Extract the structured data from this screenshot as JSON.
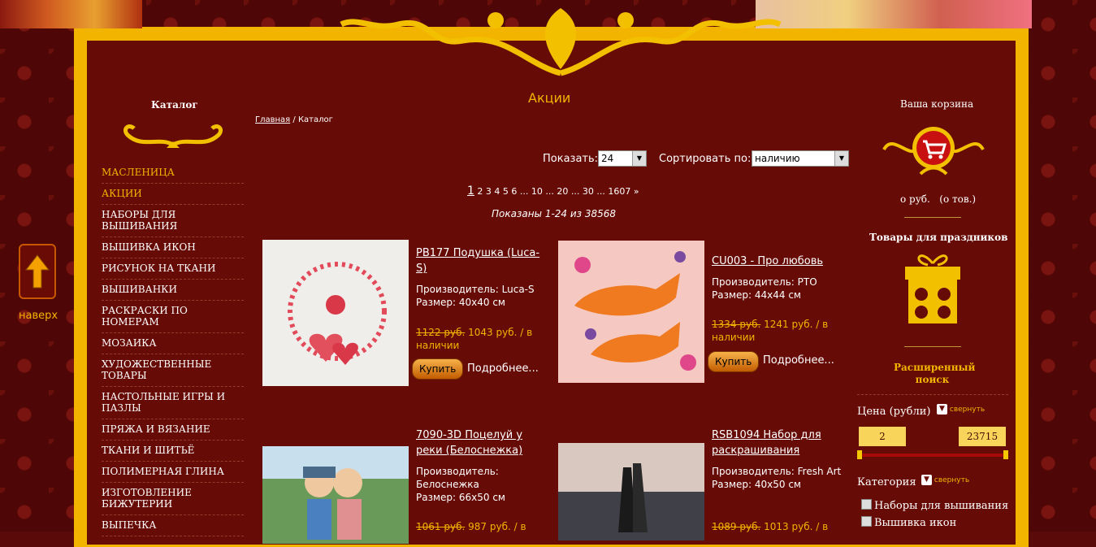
{
  "page_title": "Акции",
  "breadcrumb": {
    "home": "Главная",
    "sep": "/",
    "current": "Каталог"
  },
  "left": {
    "catalog_title": "Каталог",
    "menu": [
      {
        "label": "МАСЛЕНИЦА",
        "highlight": true
      },
      {
        "label": "АКЦИИ",
        "highlight": true
      },
      {
        "label": "НАБОРЫ ДЛЯ ВЫШИВАНИЯ"
      },
      {
        "label": "ВЫШИВКА ИКОН"
      },
      {
        "label": "РИСУНОК НА ТКАНИ"
      },
      {
        "label": "ВЫШИВАНКИ"
      },
      {
        "label": "РАСКРАСКИ ПО НОМЕРАМ"
      },
      {
        "label": "МОЗАИКА"
      },
      {
        "label": "ХУДОЖЕСТВЕННЫЕ ТОВАРЫ"
      },
      {
        "label": "НАСТОЛЬНЫЕ ИГРЫ И ПАЗЛЫ"
      },
      {
        "label": "ПРЯЖА И ВЯЗАНИЕ"
      },
      {
        "label": "ТКАНИ И ШИТЬЁ"
      },
      {
        "label": "ПОЛИМЕРНАЯ ГЛИНА"
      },
      {
        "label": "ИЗГОТОВЛЕНИЕ БИЖУТЕРИИ"
      },
      {
        "label": "ВЫПЕЧКА"
      }
    ],
    "up_label": "наверх"
  },
  "controls": {
    "show_label": "Показать:",
    "show_value": "24",
    "sort_label": "Сортировать по:",
    "sort_value": "наличию"
  },
  "pager": {
    "current": "1",
    "rest": "2 3 4 5 6 ... 10 ... 20 ... 30 ... 1607 »",
    "shown": "Показаны 1-24 из 38568"
  },
  "products": [
    {
      "name": "PB177 Подушка (Luca-S)",
      "maker": "Производитель: Luca-S",
      "size": "Размер: 40х40 см",
      "old_price": "1122 руб.",
      "price": "1043 руб. / в наличии",
      "buy": "Купить",
      "more": "Подробнее..."
    },
    {
      "name": "CU003 - Про любовь",
      "maker": "Производитель: PTO",
      "size": "Размер: 44х44 см",
      "old_price": "1334 руб.",
      "price": "1241 руб. / в наличии",
      "buy": "Купить",
      "more": "Подробнее..."
    },
    {
      "name": "7090-3D Поцелуй у реки (Белоснежка)",
      "maker": "Производитель: Белоснежка",
      "size": "Размер: 66х50 см",
      "old_price": "1061 руб.",
      "price": "987 руб. / в"
    },
    {
      "name": "RSB1094 Набор для раскрашивания",
      "maker": "Производитель: Fresh Art",
      "size": "Размер: 40х50 см",
      "old_price": "1089 руб.",
      "price": "1013 руб. / в"
    }
  ],
  "right": {
    "cart_title": "Ваша корзина",
    "cart_sum": "о руб.   (о тов.)",
    "holiday_title": "Товары для праздников",
    "adv_search": "Расширенный поиск",
    "price_label": "Цена (рубли)",
    "collapse": "свернуть",
    "price_min": "2",
    "price_max": "23715",
    "category_label": "Категория",
    "categories": [
      "Наборы для вышивания",
      "Вышивка икон"
    ]
  },
  "colors": {
    "accent": "#f3b400",
    "bg": "#670b07"
  }
}
